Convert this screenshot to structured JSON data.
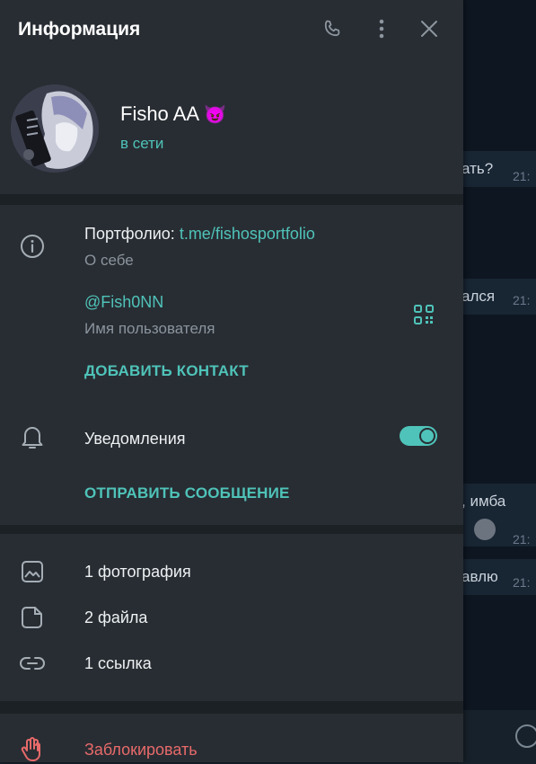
{
  "header": {
    "title": "Информация"
  },
  "profile": {
    "name": "Fisho AA",
    "emoji": "😈",
    "status": "в сети"
  },
  "info": {
    "bio_prefix": "Портфолио: ",
    "bio_link": "t.me/fishosportfolio",
    "bio_label": "О себе",
    "username": "@Fish0NN",
    "username_label": "Имя пользователя",
    "add_contact": "ДОБАВИТЬ КОНТАКТ"
  },
  "notifications": {
    "label": "Уведомления",
    "enabled": true,
    "send_message": "ОТПРАВИТЬ СООБЩЕНИЕ"
  },
  "media": {
    "photos": "1 фотография",
    "files": "2 файла",
    "links": "1 ссылка"
  },
  "block": {
    "label": "Заблокировать"
  },
  "background_chat": {
    "messages": [
      "ать?",
      "ался",
      ", имба",
      "авлю"
    ],
    "times": [
      "21:",
      "21:",
      "21:",
      "21:"
    ]
  },
  "colors": {
    "accent": "#4fc3b9",
    "danger": "#e86a6a",
    "panel": "#282d33"
  }
}
